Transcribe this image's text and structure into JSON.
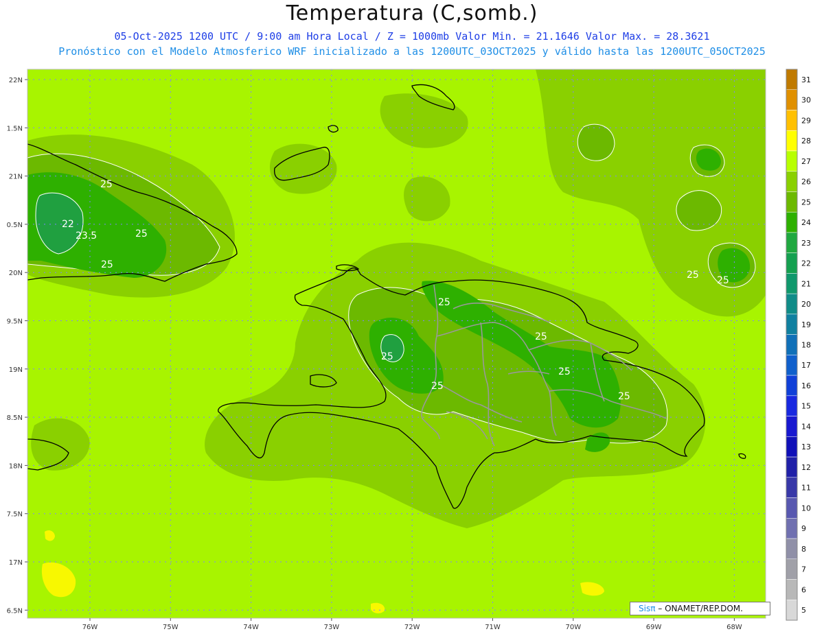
{
  "header": {
    "title": "Temperatura (C,somb.)",
    "subtitle_line1": "05-Oct-2025  1200 UTC / 9:00 am Hora Local / Z = 1000mb   Valor Min. = 21.1646  Valor Max. = 28.3621",
    "subtitle_line2": "Pronóstico con el Modelo Atmosferico WRF inicializado a las 1200UTC_03OCT2025 y válido hasta las  1200UTC_05OCT2025"
  },
  "map": {
    "lon_ticks": [
      "76W",
      "75W",
      "74W",
      "73W",
      "72W",
      "71W",
      "70W",
      "69W",
      "68W"
    ],
    "lat_ticks": [
      "22N",
      "1.5N",
      "21N",
      "0.5N",
      "20N",
      "9.5N",
      "19N",
      "8.5N",
      "18N",
      "7.5N",
      "17N",
      "6.5N"
    ],
    "contour_labels": [
      "25",
      "22",
      "23.5",
      "25",
      "25",
      "25",
      "25",
      "25",
      "25",
      "25",
      "25",
      "25",
      "25"
    ],
    "colors": {
      "background_field": "#a8f400",
      "level_26": "#8ad000",
      "level_25": "#6cb900",
      "level_24": "#2eb000",
      "level_23": "#20a040",
      "level_28": "#f8f800",
      "grid": "#8080ff",
      "coast": "#000000",
      "border": "#999999"
    }
  },
  "colorbar": {
    "labels": [
      "31",
      "30",
      "29",
      "28",
      "27",
      "26",
      "25",
      "24",
      "23",
      "22",
      "21",
      "20",
      "19",
      "18",
      "17",
      "16",
      "15",
      "14",
      "13",
      "12",
      "11",
      "10",
      "9",
      "8",
      "7",
      "6",
      "5"
    ],
    "colors": [
      "#c07a00",
      "#e09000",
      "#ffc000",
      "#ffff00",
      "#b8ff00",
      "#8ad000",
      "#6cb900",
      "#2eb000",
      "#20a840",
      "#15a050",
      "#10986c",
      "#108c88",
      "#1080a0",
      "#1070b8",
      "#1060cc",
      "#1040d8",
      "#1828e0",
      "#1818d0",
      "#1010b8",
      "#2020a8",
      "#3838a8",
      "#5858b0",
      "#7070b0",
      "#9090a8",
      "#a0a0a8",
      "#b8b8b8",
      "#d8d8d8"
    ]
  },
  "credit": {
    "logo": "Sisπ",
    "text": "– ONAMET/REP.DOM."
  }
}
